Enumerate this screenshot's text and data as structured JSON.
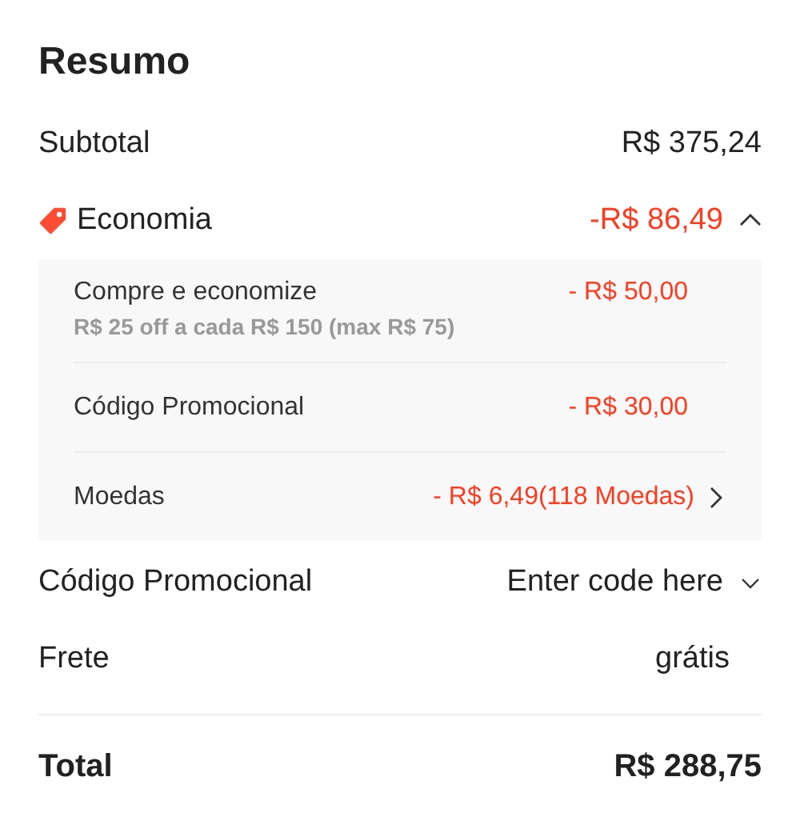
{
  "title": "Resumo",
  "subtotal": {
    "label": "Subtotal",
    "value": "R$ 375,24"
  },
  "savings": {
    "label": "Economia",
    "value": "-R$ 86,49",
    "expanded": true,
    "items": [
      {
        "kind": "plain",
        "label": "Compre e economize",
        "value": "- R$ 50,00",
        "note": "R$ 25 off a cada R$ 150 (max R$ 75)"
      },
      {
        "kind": "plain",
        "label": "Código Promocional",
        "value": "- R$ 30,00"
      },
      {
        "kind": "link",
        "label": "Moedas",
        "value": "- R$ 6,49(118 Moedas)"
      }
    ]
  },
  "promo": {
    "label": "Código Promocional",
    "placeholder": "Enter code here"
  },
  "shipping": {
    "label": "Frete",
    "value": "grátis"
  },
  "total": {
    "label": "Total",
    "value": "R$ 288,75"
  }
}
